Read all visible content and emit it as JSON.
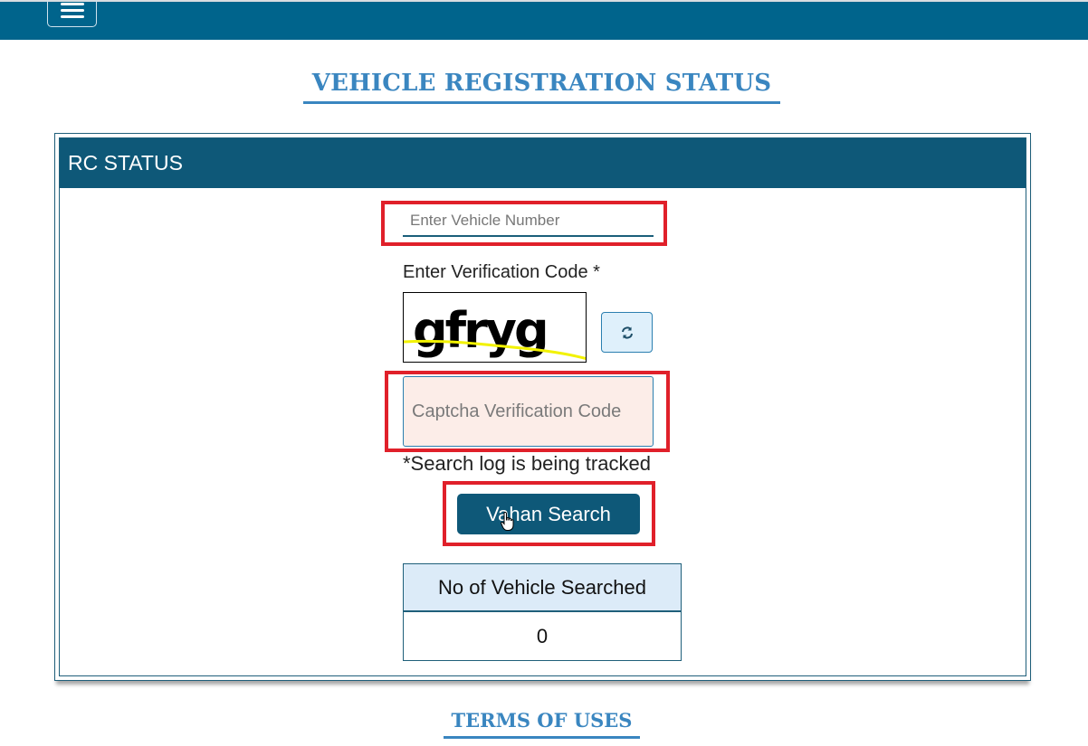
{
  "navbar": {
    "menu_icon": "hamburger-menu-icon"
  },
  "page": {
    "title": "VEHICLE REGISTRATION STATUS",
    "footer_link": "TERMS OF USES"
  },
  "card": {
    "header": "RC STATUS"
  },
  "form": {
    "vehicle_number": {
      "value": "",
      "placeholder": "Enter Vehicle Number"
    },
    "verification_label": "Enter Verification Code  *",
    "captcha_text": "gfryg",
    "refresh_icon": "refresh-icon",
    "captcha_input": {
      "value": "",
      "placeholder": "Captcha Verification Code"
    },
    "tracking_note": "*Search log is being tracked",
    "search_button": "Vahan Search"
  },
  "stats": {
    "header": "No of Vehicle Searched",
    "value": "0"
  },
  "colors": {
    "navbar": "#00648c",
    "card_header": "#0e5878",
    "title_link": "#3a86c0",
    "highlight": "#e0202a",
    "captcha_bg": "#fcede8"
  }
}
